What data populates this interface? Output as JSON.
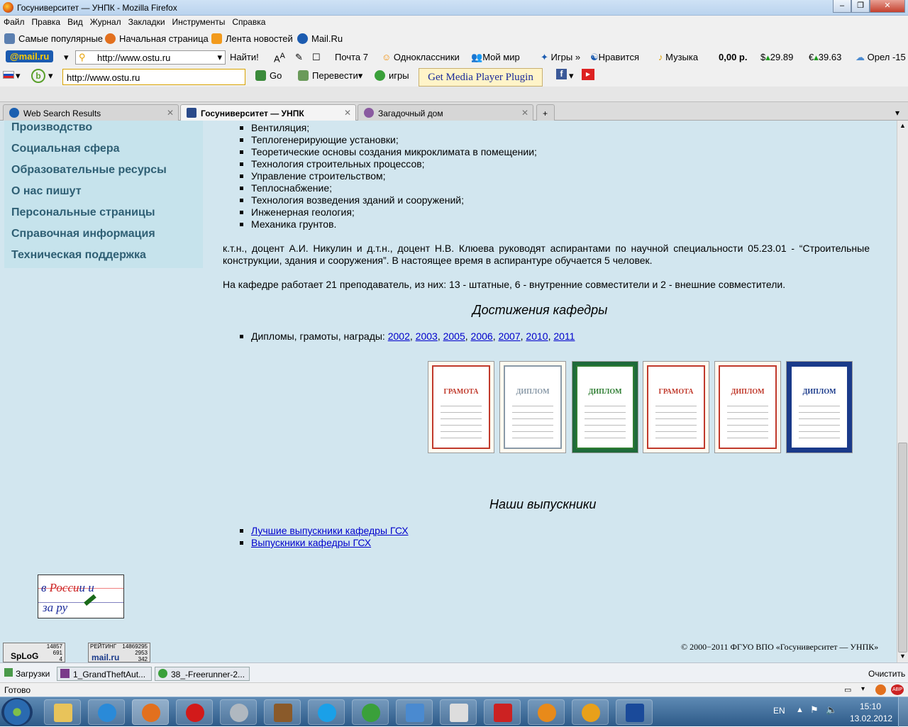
{
  "window": {
    "title": "Госуниверситет — УНПК - Mozilla Firefox"
  },
  "menu": [
    "Файл",
    "Правка",
    "Вид",
    "Журнал",
    "Закладки",
    "Инструменты",
    "Справка"
  ],
  "bookmarks": [
    "Самые популярные",
    "Начальная страница",
    "Лента новостей",
    "Mail.Ru"
  ],
  "mailbar": {
    "logo": "@mail.ru",
    "search_value": "http://www.ostu.ru",
    "find": "Найти!",
    "mail": "Почта 7",
    "ok": "Одноклассники",
    "myworld": "Мой мир",
    "games": "Игры",
    "like": "Нравится",
    "music": "Музыка",
    "balance": "0,00 р.",
    "usd": "29.89",
    "eur": "39.63",
    "weather": "Орел -15"
  },
  "navbar": {
    "url": "http://www.ostu.ru",
    "go": "Go",
    "translate": "Перевести",
    "games": "игры",
    "plugin": "Get Media Player Plugin"
  },
  "tabs": [
    {
      "label": "Web Search Results"
    },
    {
      "label": "Госуниверситет — УНПК"
    },
    {
      "label": "Загадочный дом"
    }
  ],
  "sidebar": [
    "Производство",
    "Социальная сфера",
    "Образовательные ресурсы",
    "О нас пишут",
    "Персональные страницы",
    "Справочная информация",
    "Техническая поддержка"
  ],
  "courses": [
    "Вентиляция;",
    "Теплогенерирующие установки;",
    "Теоретические основы создания микроклимата в помещении;",
    "Технология строительных процессов;",
    "Управление строительством;",
    "Теплоснабжение;",
    "Технология возведения зданий и сооружений;",
    "Инженерная геология;",
    "Механика грунтов."
  ],
  "para1": "к.т.н., доцент А.И. Никулин и д.т.н., доцент Н.В. Клюева руководят аспирантами по научной специальности 05.23.01 - “Строительные конструкции, здания и сооружения”. В настоящее время в аспирантуре обучается 5 человек.",
  "para2": "На кафедре работает 21 преподаватель, из них: 13 - штатные, 6 - внутренние совместители и 2 - внешние совместители.",
  "achievements": {
    "heading": "Достижения кафедры",
    "prefix": "Дипломы, грамоты, награды:",
    "years": [
      "2002",
      "2003",
      "2005",
      "2006",
      "2007",
      "2010",
      "2011"
    ]
  },
  "diplomas": [
    {
      "title": "ГРАМОТА",
      "color": "#c0392b"
    },
    {
      "title": "ДИПЛОМ",
      "color": "#8a9aa8"
    },
    {
      "title": "ДИПЛОМ",
      "color": "#2e7d32"
    },
    {
      "title": "ГРАМОТА",
      "color": "#c0392b"
    },
    {
      "title": "ДИПЛОМ",
      "color": "#c0392b"
    },
    {
      "title": "ДИПЛОМ",
      "color": "#1a3a8a"
    }
  ],
  "graduates": {
    "heading": "Наши выпускники",
    "links": [
      "Лучшие выпускники кафедры ГСХ",
      "Выпускники кафедры ГСХ"
    ]
  },
  "counters": {
    "c1": [
      "14857",
      "691",
      "4"
    ],
    "c2_label": "РЕЙТИНГ",
    "c2": [
      "14869295",
      "2953",
      "342"
    ]
  },
  "copyright": "© 2000−2011 ФГУО ВПО «Госуниверситет — УНПК»",
  "downloads": {
    "label": "Загрузки",
    "items": [
      "1_GrandTheftAut...",
      "38_-Freerunner-2..."
    ],
    "clear": "Очистить"
  },
  "status": "Готово",
  "tray": {
    "lang": "EN",
    "time": "15:10",
    "date": "13.02.2012"
  }
}
